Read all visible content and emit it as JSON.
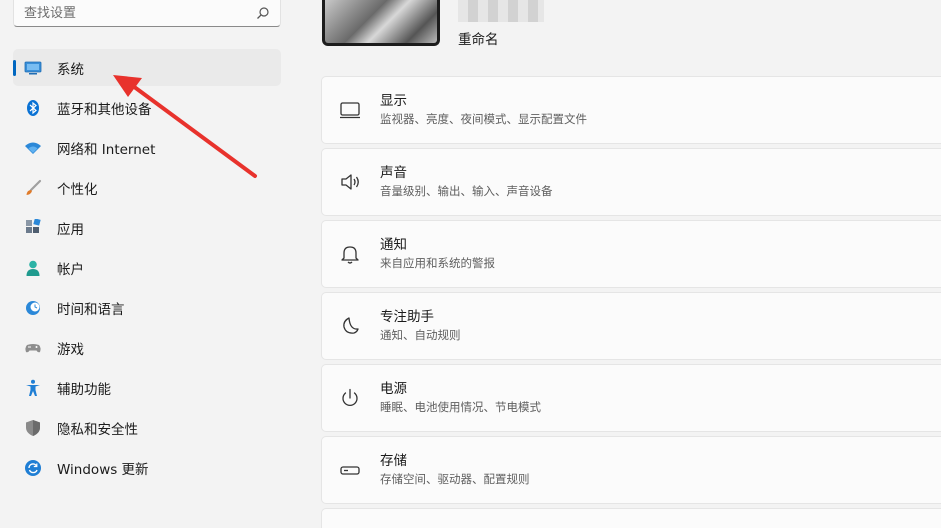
{
  "search": {
    "placeholder": "查找设置"
  },
  "sidebar": {
    "items": [
      {
        "label": "系统",
        "icon": "monitor-icon",
        "active": true
      },
      {
        "label": "蓝牙和其他设备",
        "icon": "bluetooth-icon"
      },
      {
        "label": "网络和 Internet",
        "icon": "wifi-icon"
      },
      {
        "label": "个性化",
        "icon": "brush-icon"
      },
      {
        "label": "应用",
        "icon": "apps-icon"
      },
      {
        "label": "帐户",
        "icon": "person-icon"
      },
      {
        "label": "时间和语言",
        "icon": "clock-globe-icon"
      },
      {
        "label": "游戏",
        "icon": "gamepad-icon"
      },
      {
        "label": "辅助功能",
        "icon": "accessibility-icon"
      },
      {
        "label": "隐私和安全性",
        "icon": "shield-icon"
      },
      {
        "label": "Windows 更新",
        "icon": "update-icon"
      }
    ]
  },
  "device": {
    "rename_label": "重命名"
  },
  "cards": [
    {
      "title": "显示",
      "desc": "监视器、亮度、夜间模式、显示配置文件",
      "icon": "display-icon"
    },
    {
      "title": "声音",
      "desc": "音量级别、输出、输入、声音设备",
      "icon": "speaker-icon"
    },
    {
      "title": "通知",
      "desc": "来自应用和系统的警报",
      "icon": "bell-icon"
    },
    {
      "title": "专注助手",
      "desc": "通知、自动规则",
      "icon": "moon-icon"
    },
    {
      "title": "电源",
      "desc": "睡眠、电池使用情况、节电模式",
      "icon": "power-icon"
    },
    {
      "title": "存储",
      "desc": "存储空间、驱动器、配置规则",
      "icon": "storage-icon"
    }
  ],
  "colors": {
    "accent": "#0067c0",
    "annotation": "#e8322c"
  }
}
